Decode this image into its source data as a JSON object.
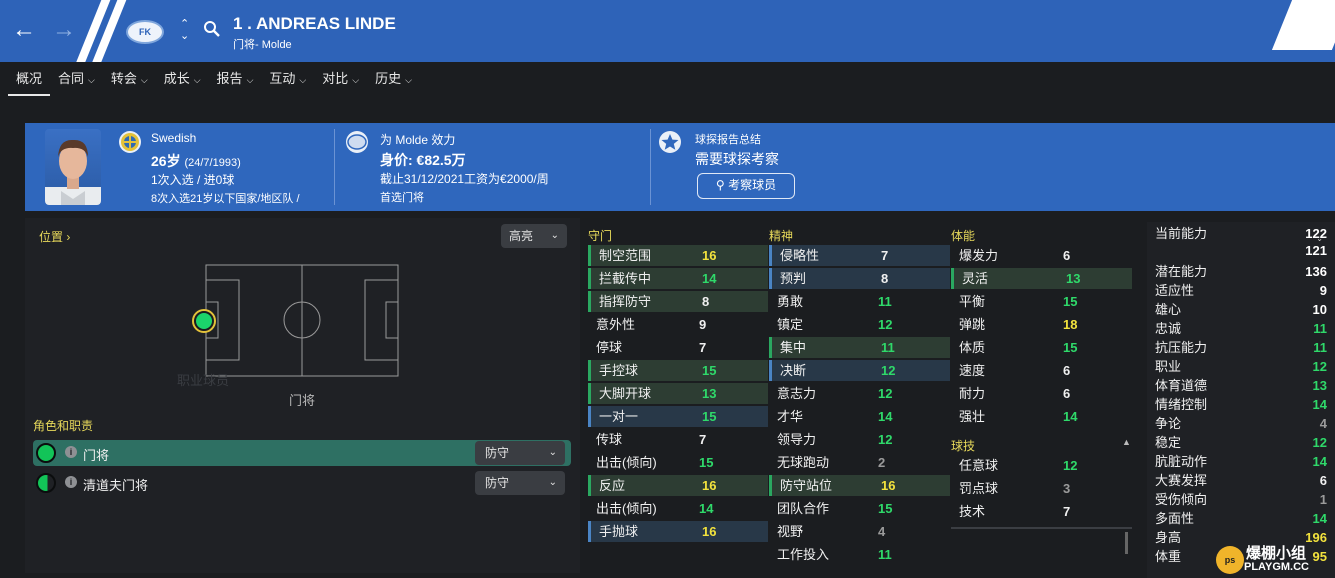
{
  "header": {
    "player_name": "1 . ANDREAS LINDE",
    "subtitle": "门将- Molde",
    "club_badge_text": "FK",
    "back_icon": "arrow-left-icon",
    "forward_icon": "arrow-right-icon",
    "search_icon": "search-icon"
  },
  "tabs": [
    {
      "label": "概况"
    },
    {
      "label": "合同"
    },
    {
      "label": "转会"
    },
    {
      "label": "成长"
    },
    {
      "label": "报告"
    },
    {
      "label": "互动"
    },
    {
      "label": "对比"
    },
    {
      "label": "历史"
    }
  ],
  "info": {
    "nationality": "Swedish",
    "age": "26岁",
    "birth": "(24/7/1993)",
    "caps": "1次入选 / 进0球",
    "youth_caps": "8次入选21岁以下国家/地区队 /",
    "club_line": "为 Molde 效力",
    "value": "身价: €82.5万",
    "contract": "截止31/12/2021工资为€2000/周",
    "squad_role": "首选门将",
    "scout_title": "球探报告总结",
    "scout_status": "需要球探考察",
    "scout_button": "考察球员"
  },
  "position": {
    "label": "位置",
    "highlight": "高亮",
    "pitch_caption": "门将",
    "ghost_text": "职业球员"
  },
  "roles": {
    "header": "角色和职责",
    "items": [
      {
        "name": "门将",
        "duty": "防守"
      },
      {
        "name": "清道夫门将",
        "duty": "防守"
      }
    ]
  },
  "attributes": {
    "goalkeeping": {
      "title": "守门",
      "rows": [
        {
          "name": "制空范围",
          "value": "16"
        },
        {
          "name": "拦截传中",
          "value": "14"
        },
        {
          "name": "指挥防守",
          "value": "8"
        },
        {
          "name": "意外性",
          "value": "9"
        },
        {
          "name": "停球",
          "value": "7"
        },
        {
          "name": "手控球",
          "value": "15"
        },
        {
          "name": "大脚开球",
          "value": "13"
        },
        {
          "name": "一对一",
          "value": "15"
        },
        {
          "name": "传球",
          "value": "7"
        },
        {
          "name": "出击(倾向)",
          "value": "15"
        },
        {
          "name": "反应",
          "value": "16"
        },
        {
          "name": "出击(倾向)",
          "value": "14"
        },
        {
          "name": "手抛球",
          "value": "16"
        }
      ]
    },
    "mental": {
      "title": "精神",
      "rows": [
        {
          "name": "侵略性",
          "value": "7"
        },
        {
          "name": "预判",
          "value": "8"
        },
        {
          "name": "勇敢",
          "value": "11"
        },
        {
          "name": "镇定",
          "value": "12"
        },
        {
          "name": "集中",
          "value": "11"
        },
        {
          "name": "决断",
          "value": "12"
        },
        {
          "name": "意志力",
          "value": "12"
        },
        {
          "name": "才华",
          "value": "14"
        },
        {
          "name": "领导力",
          "value": "12"
        },
        {
          "name": "无球跑动",
          "value": "2"
        },
        {
          "name": "防守站位",
          "value": "16"
        },
        {
          "name": "团队合作",
          "value": "15"
        },
        {
          "name": "视野",
          "value": "4"
        },
        {
          "name": "工作投入",
          "value": "11"
        }
      ]
    },
    "physical": {
      "title": "体能",
      "rows": [
        {
          "name": "爆发力",
          "value": "6"
        },
        {
          "name": "灵活",
          "value": "13"
        },
        {
          "name": "平衡",
          "value": "15"
        },
        {
          "name": "弹跳",
          "value": "18"
        },
        {
          "name": "体质",
          "value": "15"
        },
        {
          "name": "速度",
          "value": "6"
        },
        {
          "name": "耐力",
          "value": "6"
        },
        {
          "name": "强壮",
          "value": "14"
        }
      ]
    },
    "technical": {
      "title": "球技",
      "rows": [
        {
          "name": "任意球",
          "value": "12"
        },
        {
          "name": "罚点球",
          "value": "3"
        },
        {
          "name": "技术",
          "value": "7"
        }
      ]
    }
  },
  "ability": {
    "current_label": "当前能力",
    "current_value": "122",
    "current_second": "121",
    "rows": [
      {
        "name": "潜在能力",
        "value": "136"
      },
      {
        "name": "适应性",
        "value": "9"
      },
      {
        "name": "雄心",
        "value": "10"
      },
      {
        "name": "忠诚",
        "value": "11"
      },
      {
        "name": "抗压能力",
        "value": "11"
      },
      {
        "name": "职业",
        "value": "12"
      },
      {
        "name": "体育道德",
        "value": "13"
      },
      {
        "name": "情绪控制",
        "value": "14"
      },
      {
        "name": "争论",
        "value": "4"
      },
      {
        "name": "稳定",
        "value": "12"
      },
      {
        "name": "肮脏动作",
        "value": "14"
      },
      {
        "name": "大赛发挥",
        "value": "6"
      },
      {
        "name": "受伤倾向",
        "value": "1"
      },
      {
        "name": "多面性",
        "value": "14"
      },
      {
        "name": "身高",
        "value": "196"
      },
      {
        "name": "体重",
        "value": "95"
      }
    ]
  },
  "watermark": {
    "line1": "爆棚小组",
    "line2": "PLAYGM.CC"
  }
}
